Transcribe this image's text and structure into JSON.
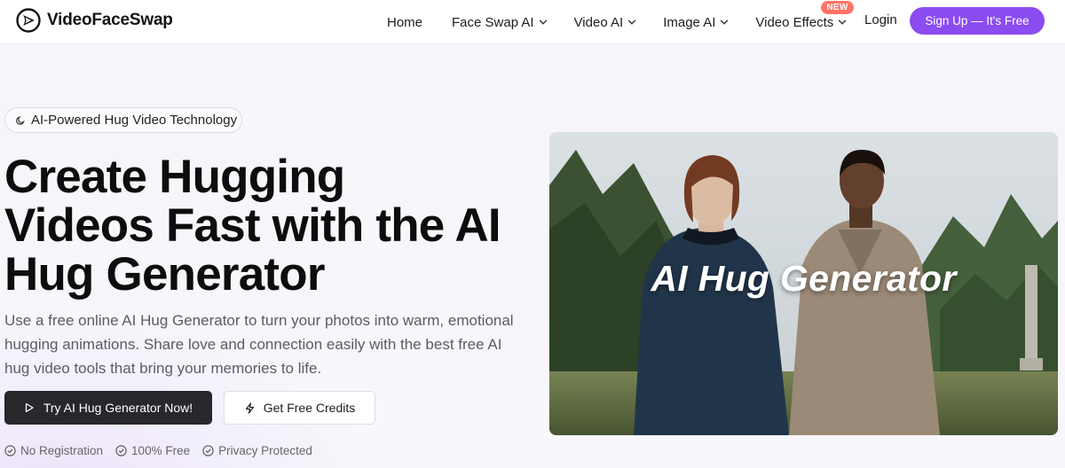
{
  "header": {
    "brand": "VideoFaceSwap",
    "nav": {
      "home": "Home",
      "face_swap": "Face Swap AI",
      "video_ai": "Video AI",
      "image_ai": "Image AI",
      "video_effects": "Video Effects",
      "new_badge": "NEW"
    },
    "login": "Login",
    "signup": "Sign Up — It's Free"
  },
  "hero": {
    "pill": "AI-Powered Hug Video Technology",
    "title_lines": [
      "Create Hugging",
      "Videos Fast with the AI",
      "Hug Generator"
    ],
    "description": "Use a free online AI Hug Generator to turn your photos into warm, emotional hugging animations. Share love and connection easily with the best free AI hug video tools that bring your memories to life.",
    "primary_button": "Try AI Hug Generator Now!",
    "secondary_button": "Get Free Credits",
    "features": [
      "No Registration",
      "100% Free",
      "Privacy Protected"
    ],
    "image_overlay": "AI Hug Generator"
  },
  "colors": {
    "accent": "#8b4cf0",
    "new_badge": "#ff7466",
    "primary_button": "#27272c"
  },
  "icons": {
    "logo": "play-logo-icon",
    "chevron": "chevron-down-icon",
    "pill": "sparkle-icon",
    "primary": "play-icon",
    "secondary": "lightning-icon",
    "features": "check-circle-icon"
  }
}
